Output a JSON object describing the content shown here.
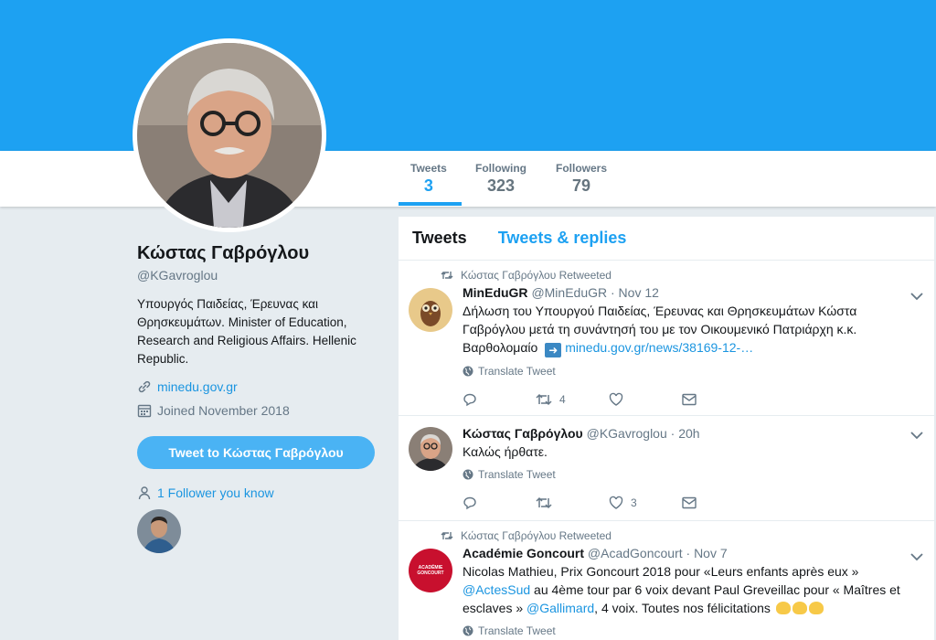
{
  "stats": [
    {
      "label": "Tweets",
      "value": "3"
    },
    {
      "label": "Following",
      "value": "323"
    },
    {
      "label": "Followers",
      "value": "79"
    }
  ],
  "profile": {
    "name": "Κώστας Γαβρόγλου",
    "handle": "@KGavroglou",
    "bio": "Υπουργός Παιδείας, Έρευνας και Θρησκευμάτων. Minister of Education, Research and Religious Affairs. Hellenic Republic.",
    "website": "minedu.gov.gr",
    "joined": "Joined November 2018",
    "tweet_to_label": "Tweet to Κώστας Γαβρόγλου",
    "follower_you_know": "1 Follower you know"
  },
  "timeline": {
    "tabs": [
      "Tweets",
      "Tweets & replies"
    ],
    "translate_label": "Translate Tweet",
    "tweets": [
      {
        "retweet_note": "Κώστας Γαβρόγλου Retweeted",
        "name": "MinEduGR",
        "handle": "@MinEduGR · Nov 12",
        "text": "Δήλωση του Υπουργού Παιδείας, Έρευνας και Θρησκευμάτων Κώστα Γαβρόγλου μετά τη συνάντησή του με τον Οικουμενικό Πατριάρχη κ.κ. Βαρθολομαίο",
        "link": "minedu.gov.gr/news/38169-12-…",
        "retweets": "4",
        "likes": ""
      },
      {
        "retweet_note": "",
        "name": "Κώστας Γαβρόγλου",
        "handle": "@KGavroglou · 20h",
        "text": "Καλώς ήρθατε.",
        "link": "",
        "retweets": "",
        "likes": "3"
      },
      {
        "retweet_note": "Κώστας Γαβρόγλου Retweeted",
        "name": "Académie Goncourt",
        "handle": "@AcadGoncourt · Nov 7",
        "text_a": "Nicolas Mathieu, Prix Goncourt 2018 pour «Leurs enfants après eux » ",
        "mention_a": "@ActesSud",
        "text_b": " au 4ème tour par 6 voix devant Paul Greveillac pour « Maîtres et esclaves » ",
        "mention_b": "@Gallimard",
        "text_c": ", 4 voix. Toutes nos félicitations",
        "avatar_text": "ACADÉMIE GONCOURT"
      }
    ]
  },
  "colors": {
    "accent": "#1da1f2",
    "link": "#1b95e0",
    "background": "#e6ecf0"
  }
}
